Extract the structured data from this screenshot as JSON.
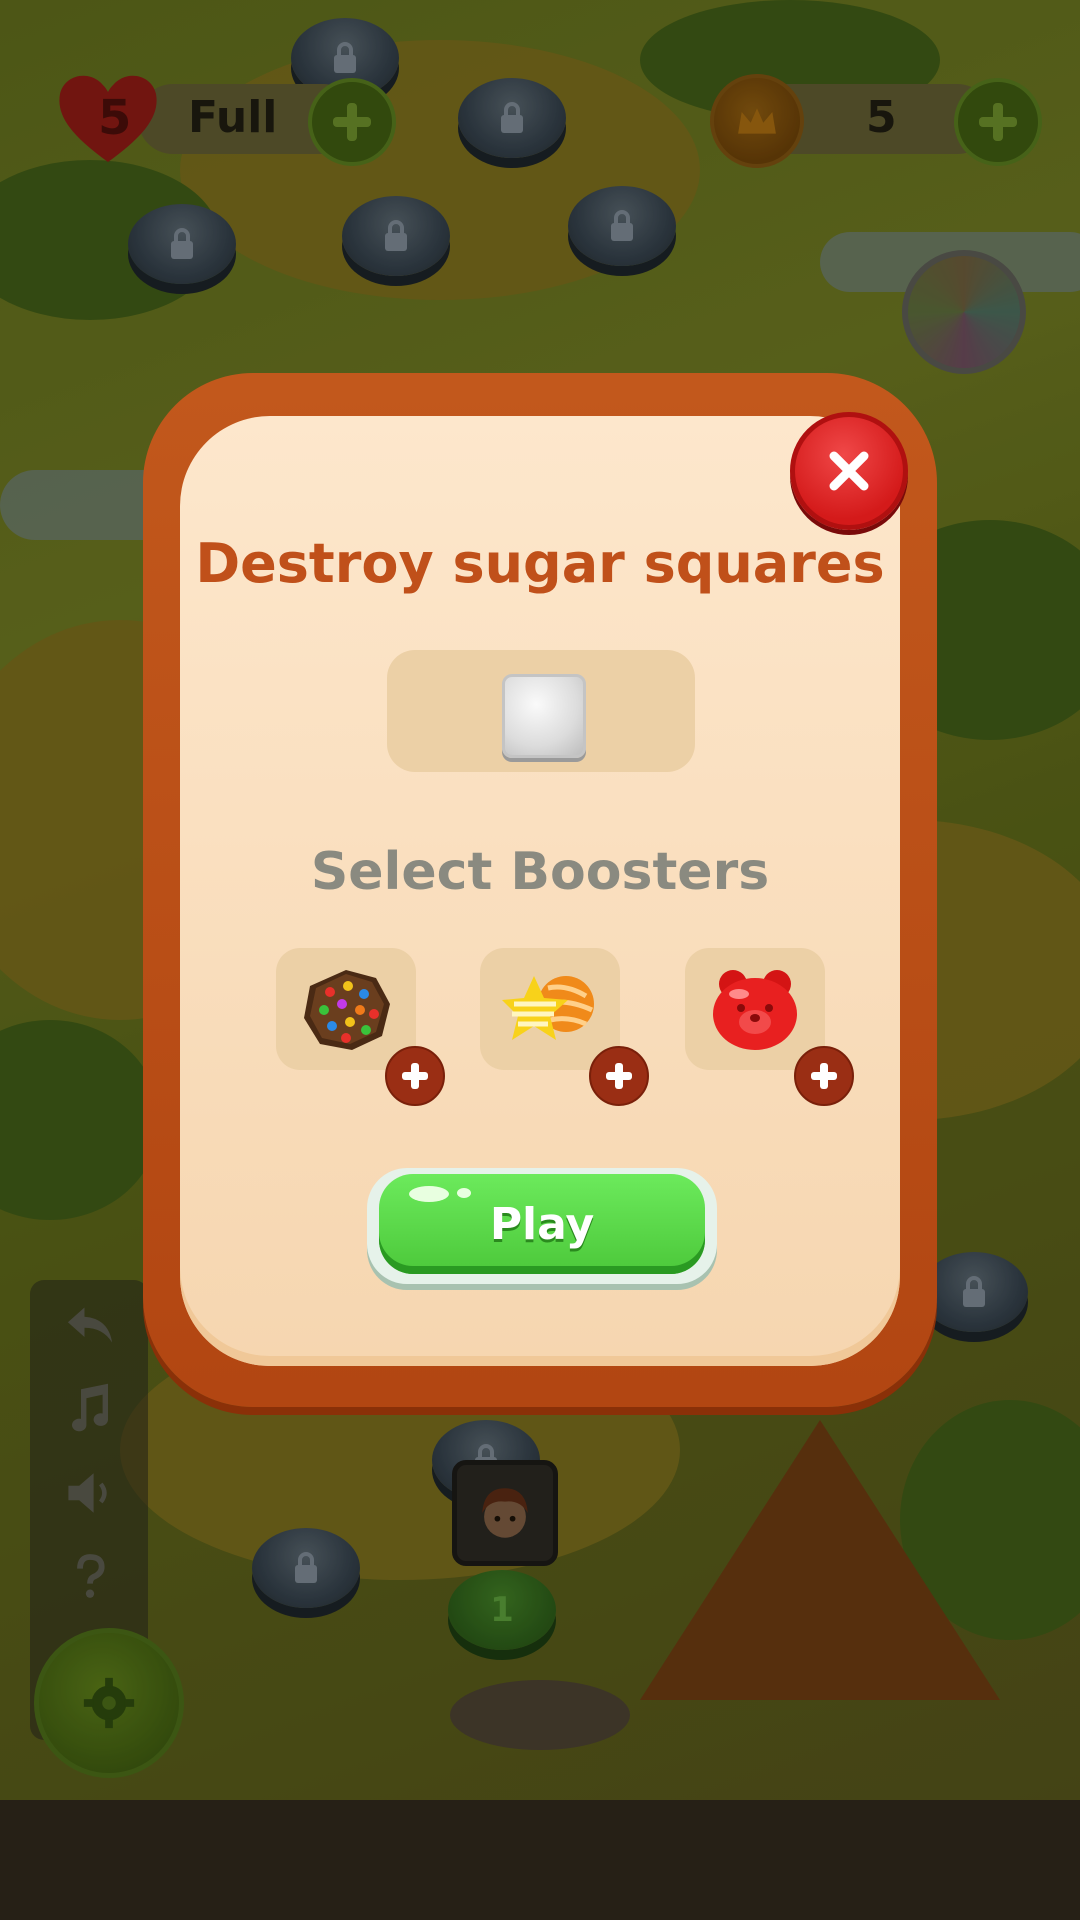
{
  "hud": {
    "lives_count": "5",
    "lives_status": "Full",
    "coins_count": "5"
  },
  "dialog": {
    "title": "Destroy sugar squares",
    "subtitle": "Select Boosters",
    "play_label": "Play",
    "boosters": [
      {
        "name": "chocolate-candy-booster"
      },
      {
        "name": "striped-candy-booster"
      },
      {
        "name": "jelly-bear-booster"
      }
    ]
  },
  "map": {
    "current_level": "1"
  },
  "colors": {
    "frame": "#c2581c",
    "panel": "#fde7cc",
    "title": "#c0501a",
    "subtitle": "#8a8a80",
    "play": "#4cc83a",
    "close": "#d41a1a"
  }
}
